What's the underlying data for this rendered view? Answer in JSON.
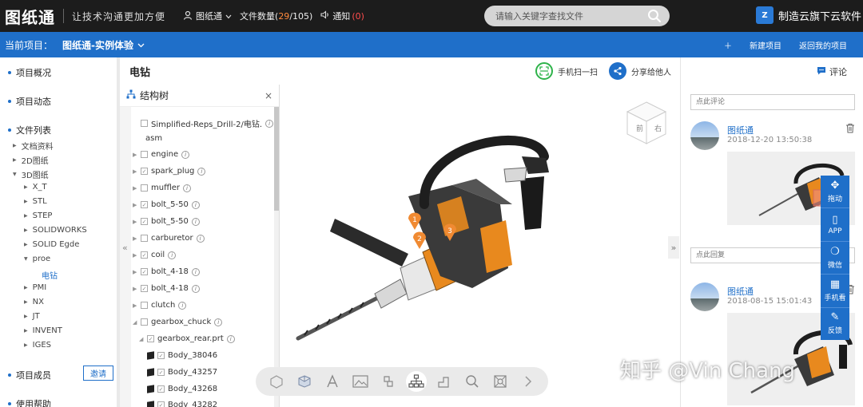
{
  "header": {
    "logo": "图纸通",
    "slogan": "让技术沟通更加方便",
    "user": "图纸通",
    "file_count_label": "文件数量(",
    "file_count_used": "29",
    "file_count_total": "/105)",
    "notice_label": "通知",
    "notice_count": "(0)",
    "search_placeholder": "请输入关键字查找文件",
    "brand": "制造云旗下云软件",
    "brand_logo": "Z"
  },
  "project_bar": {
    "label": "当前项目：",
    "project_name": "图纸通-实例体验",
    "new_project": "新建项目",
    "back": "返回我的项目"
  },
  "sidebar": {
    "overview": "项目概况",
    "activity": "项目动态",
    "file_list": "文件列表",
    "docs": "文档资料",
    "d2": "2D图纸",
    "d3": "3D图纸",
    "formats": [
      "X_T",
      "STL",
      "STEP",
      "SOLIDWORKS",
      "SOLID Egde",
      "proe"
    ],
    "active_file": "电钻",
    "formats2": [
      "PMI",
      "NX",
      "JT",
      "INVENT",
      "IGES"
    ],
    "members": "项目成员",
    "invite": "邀请",
    "help": "使用帮助"
  },
  "main": {
    "title": "电钻",
    "scan": "手机扫一扫",
    "share": "分享给他人"
  },
  "tree": {
    "title": "结构树",
    "close": "×",
    "root": "Simplified-Reps_Drill-2/电钻.",
    "root2": "asm",
    "nodes": [
      "engine",
      "spark_plug",
      "muffler",
      "bolt_5-50",
      "bolt_5-50",
      "carburetor",
      "coil",
      "bolt_4-18",
      "bolt_4-18",
      "clutch",
      "gearbox_chuck"
    ],
    "sub": "gearbox_rear.prt",
    "bodies": [
      "Body_38046",
      "Body_43257",
      "Body_43268",
      "Body_43282"
    ]
  },
  "viewcube": {
    "front": "前",
    "right": "右"
  },
  "markers": [
    "1",
    "2",
    "3"
  ],
  "comments": {
    "tab": "评论",
    "comment_placeholder": "点此评论",
    "reply_placeholder": "点此回复",
    "entries": [
      {
        "user": "图纸通",
        "time": "2018-12-20 13:50:38"
      },
      {
        "user": "图纸通",
        "time": "2018-08-15 15:01:43"
      }
    ]
  },
  "floatbar": [
    "拖动",
    "APP",
    "微信",
    "手机看",
    "反馈"
  ],
  "watermark": "知乎 @Vin Chang"
}
